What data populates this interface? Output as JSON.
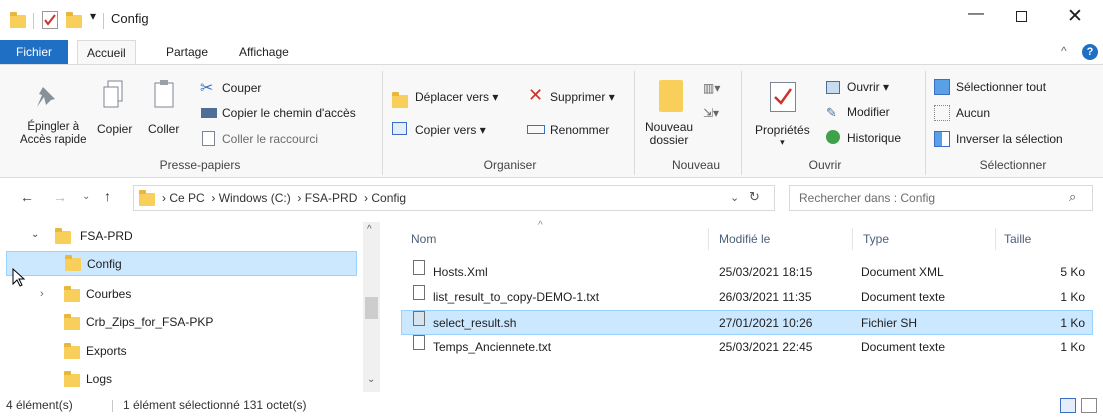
{
  "titlebar": {
    "title": "Config"
  },
  "tabs": [
    "Fichier",
    "Accueil",
    "Partage",
    "Affichage"
  ],
  "ribbon": {
    "clipboard": {
      "pin": "Épingler à\nAccès rapide",
      "pin_l1": "Épingler à",
      "pin_l2": "Accès rapide",
      "copy": "Copier",
      "paste": "Coller",
      "cut": "Couper",
      "copy_path": "Copier le chemin d'accès",
      "paste_shortcut": "Coller le raccourci",
      "label": "Presse-papiers"
    },
    "organize": {
      "move_to": "Déplacer vers",
      "copy_to": "Copier vers",
      "delete": "Supprimer",
      "rename": "Renommer",
      "label": "Organiser"
    },
    "new": {
      "new_folder_l1": "Nouveau",
      "new_folder_l2": "dossier",
      "label": "Nouveau"
    },
    "open": {
      "properties": "Propriétés",
      "open": "Ouvrir",
      "edit": "Modifier",
      "history": "Historique",
      "label": "Ouvrir"
    },
    "select": {
      "select_all": "Sélectionner tout",
      "select_none": "Aucun",
      "invert": "Inverser la sélection",
      "label": "Sélectionner"
    }
  },
  "address": {
    "crumbs": [
      "Ce PC",
      "Windows (C:)",
      "FSA-PRD",
      "Config"
    ],
    "search_placeholder": "Rechercher dans : Config"
  },
  "tree": [
    {
      "label": "FSA-PRD"
    },
    {
      "label": "Config"
    },
    {
      "label": "Courbes"
    },
    {
      "label": "Crb_Zips_for_FSA-PKP"
    },
    {
      "label": "Exports"
    },
    {
      "label": "Logs"
    }
  ],
  "columns": {
    "name": "Nom",
    "modified": "Modifié le",
    "type": "Type",
    "size": "Taille"
  },
  "files": [
    {
      "name": "Hosts.Xml",
      "modified": "25/03/2021 18:15",
      "type": "Document XML",
      "size": "5 Ko"
    },
    {
      "name": "list_result_to_copy-DEMO-1.txt",
      "modified": "26/03/2021 11:35",
      "type": "Document texte",
      "size": "1 Ko"
    },
    {
      "name": "select_result.sh",
      "modified": "27/01/2021 10:26",
      "type": "Fichier SH",
      "size": "1 Ko"
    },
    {
      "name": "Temps_Anciennete.txt",
      "modified": "25/03/2021 22:45",
      "type": "Document texte",
      "size": "1 Ko"
    }
  ],
  "status": {
    "count": "4 élément(s)",
    "selection": "1 élément sélectionné 131 octet(s)"
  },
  "colors": {
    "file_tab": "#1f6fc5",
    "selection": "#cce8ff",
    "selection_border": "#99d1ff",
    "folder": "#f7cf5a"
  }
}
